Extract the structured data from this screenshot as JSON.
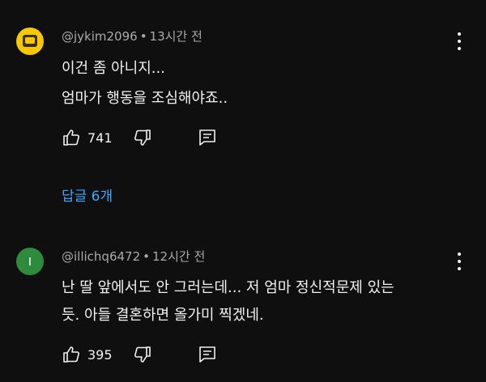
{
  "comments": [
    {
      "author": "@jykim2096",
      "separator": "•",
      "time": "13시간 전",
      "lines": [
        "이건 좀 아니지...",
        "엄마가 행동을 조심해야죠.."
      ],
      "likes": "741",
      "replies_label": "답글 6개",
      "avatar_color": "#f5c800"
    },
    {
      "author": "@illichq6472",
      "separator": "•",
      "time": "12시간 전",
      "avatar_letter": "I",
      "lines": [
        "난 딸 앞에서도 안 그러는데... 저 엄마 정신적문제 있는",
        "듯. 아들 결혼하면 올가미 찍겠네."
      ],
      "likes": "395",
      "avatar_color": "#2e8b3d"
    }
  ],
  "icons": [
    "thumb-up-icon",
    "thumb-down-icon",
    "reply-comment-icon",
    "more-vert-icon"
  ],
  "colors": {
    "background": "#0f0f0f",
    "link": "#3ea6ff",
    "meta_text": "#aaaaaa",
    "text": "#f1f1f1"
  }
}
